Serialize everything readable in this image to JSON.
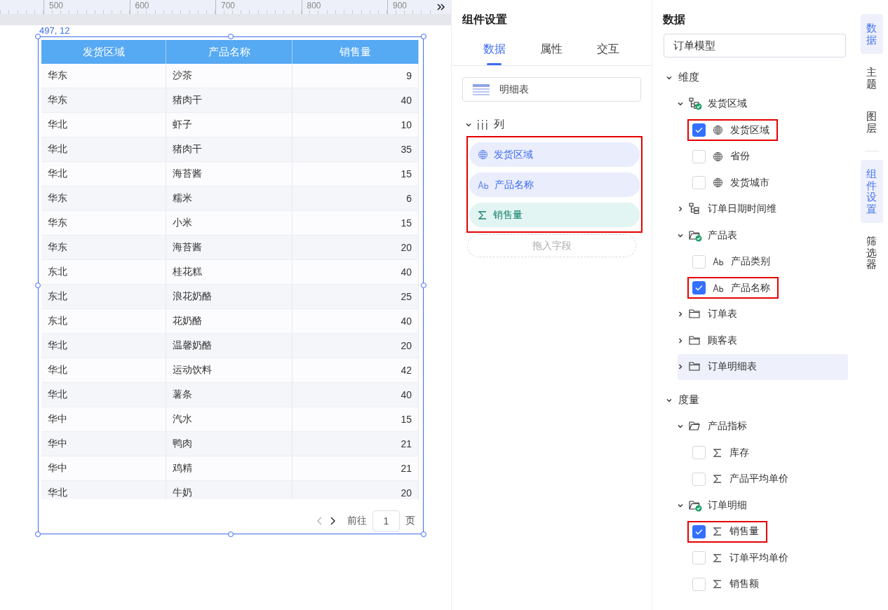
{
  "ruler": {
    "labels": [
      "500",
      "600",
      "700",
      "800",
      "900"
    ]
  },
  "canvas": {
    "position": "497, 12",
    "table": {
      "columns": [
        "发货区域",
        "产品名称",
        "销售量"
      ],
      "rows": [
        [
          "华东",
          "沙茶",
          "9"
        ],
        [
          "华东",
          "猪肉干",
          "40"
        ],
        [
          "华北",
          "虾子",
          "10"
        ],
        [
          "华北",
          "猪肉干",
          "35"
        ],
        [
          "华北",
          "海苔酱",
          "15"
        ],
        [
          "华东",
          "糯米",
          "6"
        ],
        [
          "华东",
          "小米",
          "15"
        ],
        [
          "华东",
          "海苔酱",
          "20"
        ],
        [
          "东北",
          "桂花糕",
          "40"
        ],
        [
          "东北",
          "浪花奶酪",
          "25"
        ],
        [
          "东北",
          "花奶酪",
          "40"
        ],
        [
          "华北",
          "温馨奶酪",
          "20"
        ],
        [
          "华北",
          "运动饮料",
          "42"
        ],
        [
          "华北",
          "薯条",
          "40"
        ],
        [
          "华中",
          "汽水",
          "15"
        ],
        [
          "华中",
          "鸭肉",
          "21"
        ],
        [
          "华中",
          "鸡精",
          "21"
        ],
        [
          "华北",
          "牛奶",
          "20"
        ]
      ]
    },
    "pagination": {
      "goto_label": "前往",
      "page": "1",
      "page_suffix": "页"
    }
  },
  "settings": {
    "title": "组件设置",
    "tabs": [
      {
        "label": "数据",
        "selected": true
      },
      {
        "label": "属性",
        "selected": false
      },
      {
        "label": "交互",
        "selected": false
      }
    ],
    "chart_type": "明细表",
    "columns_section": {
      "label": "列",
      "expanded": true,
      "highlighted": true,
      "fields": [
        {
          "kind": "geo",
          "label": "发货区域"
        },
        {
          "kind": "text",
          "label": "产品名称"
        },
        {
          "kind": "measure",
          "label": "销售量"
        }
      ],
      "drop_hint": "拖入字段"
    }
  },
  "data_panel": {
    "title": "数据",
    "model": "订单模型",
    "tree": [
      {
        "kind": "section",
        "label": "维度",
        "expanded": true,
        "children": [
          {
            "kind": "hierarchy",
            "label": "发货区域",
            "expanded": true,
            "used": true,
            "selected": false,
            "children": [
              {
                "kind": "geo_field",
                "label": "发货区域",
                "checked": true,
                "highlighted": true
              },
              {
                "kind": "geo_field",
                "label": "省份",
                "checked": false,
                "highlighted": false
              },
              {
                "kind": "geo_field",
                "label": "发货城市",
                "checked": false,
                "highlighted": false
              }
            ]
          },
          {
            "kind": "hierarchy",
            "label": "订单日期时间维",
            "expanded": false,
            "used": false,
            "selected": false
          },
          {
            "kind": "table",
            "label": "产品表",
            "expanded": true,
            "used": true,
            "selected": false,
            "children": [
              {
                "kind": "text_field",
                "label": "产品类别",
                "checked": false,
                "highlighted": false
              },
              {
                "kind": "text_field",
                "label": "产品名称",
                "checked": true,
                "highlighted": true
              }
            ]
          },
          {
            "kind": "table",
            "label": "订单表",
            "expanded": false,
            "used": false,
            "selected": false
          },
          {
            "kind": "table",
            "label": "顾客表",
            "expanded": false,
            "used": false,
            "selected": false
          },
          {
            "kind": "table",
            "label": "订单明细表",
            "expanded": false,
            "used": false,
            "selected": true
          }
        ]
      },
      {
        "kind": "section",
        "label": "度量",
        "expanded": true,
        "children": [
          {
            "kind": "table",
            "label": "产品指标",
            "expanded": true,
            "used": false,
            "selected": false,
            "children": [
              {
                "kind": "measure_field",
                "label": "库存",
                "checked": false,
                "highlighted": false
              },
              {
                "kind": "measure_field",
                "label": "产品平均单价",
                "checked": false,
                "highlighted": false
              }
            ]
          },
          {
            "kind": "table",
            "label": "订单明细",
            "expanded": true,
            "used": true,
            "selected": false,
            "children": [
              {
                "kind": "measure_field",
                "label": "销售量",
                "checked": true,
                "highlighted": true
              },
              {
                "kind": "measure_field",
                "label": "订单平均单价",
                "checked": false,
                "highlighted": false
              },
              {
                "kind": "measure_field",
                "label": "销售额",
                "checked": false,
                "highlighted": false
              }
            ]
          }
        ]
      }
    ]
  },
  "rail": [
    {
      "label": "数据",
      "selected": true
    },
    {
      "label": "主题",
      "selected": false
    },
    {
      "label": "图层",
      "selected": false
    },
    {
      "kind": "divider"
    },
    {
      "label": "组件设置",
      "selected": true
    },
    {
      "label": "筛选器",
      "selected": false
    }
  ]
}
